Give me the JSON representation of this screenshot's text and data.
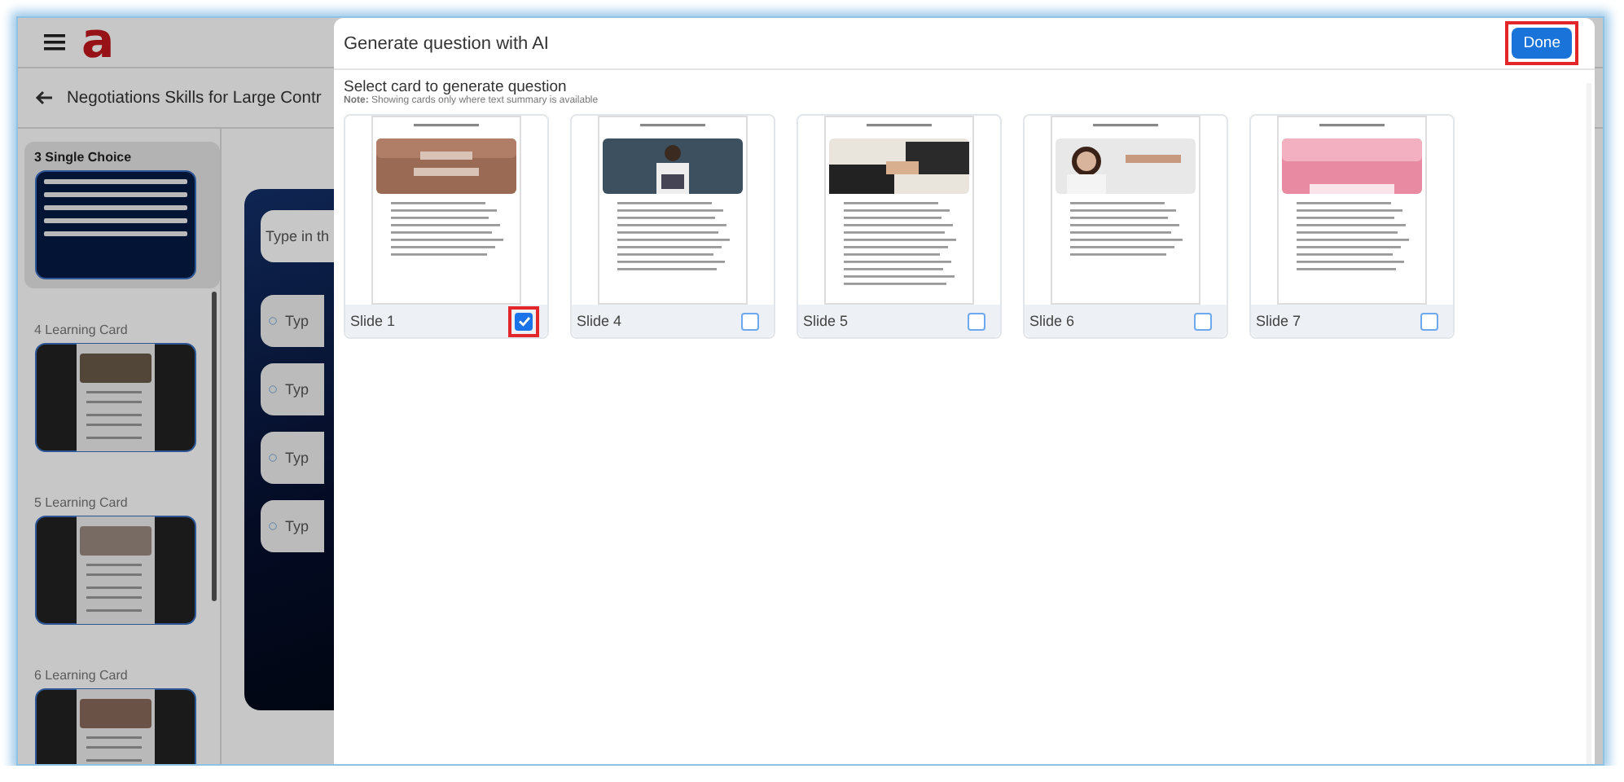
{
  "app": {
    "logo": "a",
    "title": "Negotiations Skills for Large Contr",
    "sidebar": {
      "items": [
        {
          "label": "3 Single Choice",
          "kind": "question",
          "selected": true
        },
        {
          "label": "4 Learning Card",
          "kind": "learning",
          "selected": false
        },
        {
          "label": "5 Learning Card",
          "kind": "learning",
          "selected": false
        },
        {
          "label": "6 Learning Card",
          "kind": "learning",
          "selected": false
        }
      ]
    },
    "question": {
      "placeholder": "Type in th",
      "options": [
        {
          "placeholder": "Typ",
          "selected": false
        },
        {
          "placeholder": "Typ",
          "selected": false
        },
        {
          "placeholder": "Typ",
          "selected": false
        },
        {
          "placeholder": "Typ",
          "selected": false
        }
      ]
    }
  },
  "dialog": {
    "title": "Generate question with AI",
    "done_button": {
      "label": "Done",
      "highlighted": true
    },
    "heading": "Select card to generate question",
    "note": "**Note:** Showing cards only where text summary is available",
    "slides": [
      {
        "label": "Slide 1",
        "checked": true,
        "highlighted": true
      },
      {
        "label": "Slide 4",
        "checked": false,
        "highlighted": false
      },
      {
        "label": "Slide 5",
        "checked": false,
        "highlighted": false
      },
      {
        "label": "Slide 6",
        "checked": false,
        "highlighted": false
      },
      {
        "label": "Slide 7",
        "checked": false,
        "highlighted": false
      }
    ]
  }
}
